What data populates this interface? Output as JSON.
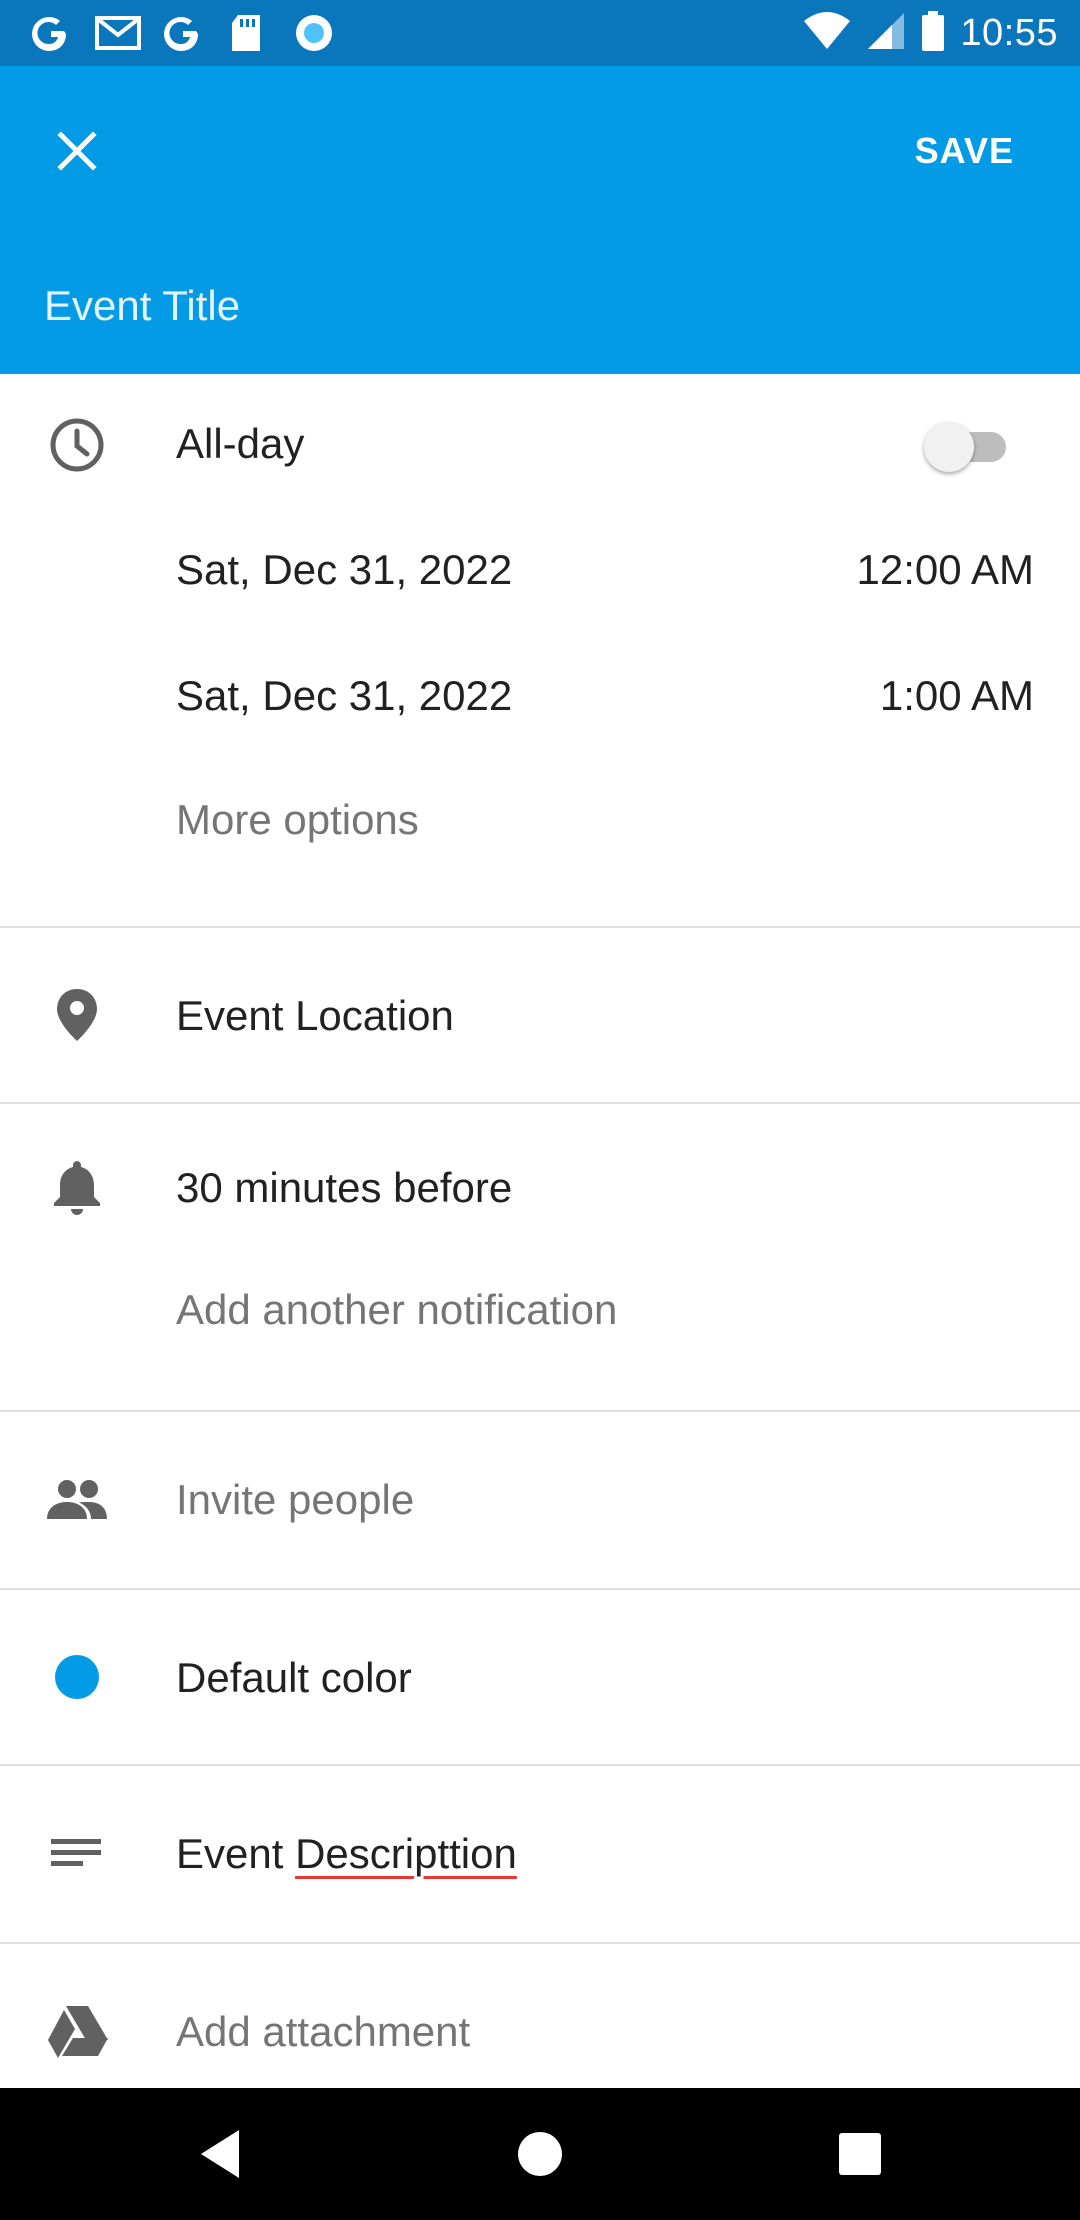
{
  "status_bar": {
    "time": "10:55",
    "left_icons": [
      "google-g-icon",
      "gmail-icon",
      "google-g-icon",
      "sd-card-icon",
      "record-icon"
    ],
    "right_icons": [
      "wifi-icon",
      "cell-signal-icon",
      "battery-icon"
    ]
  },
  "app_bar": {
    "close_icon": "close-icon",
    "save_label": "SAVE",
    "title_placeholder": "Event Title",
    "background_color": "#039be5"
  },
  "time_section": {
    "all_day_label": "All-day",
    "all_day_enabled": false,
    "start_date": "Sat, Dec 31, 2022",
    "start_time": "12:00 AM",
    "end_date": "Sat, Dec 31, 2022",
    "end_time": "1:00 AM",
    "more_options": "More options"
  },
  "location": {
    "placeholder": "Event Location"
  },
  "notifications": {
    "current": "30 minutes before",
    "add_label": "Add another notification"
  },
  "invite": {
    "label": "Invite people"
  },
  "color": {
    "label": "Default color",
    "value": "#039be5"
  },
  "description": {
    "word1": "Event",
    "word2": "Descripttion"
  },
  "attachment": {
    "label": "Add attachment"
  },
  "nav_bar": {
    "icons": [
      "back-icon",
      "home-icon",
      "recents-icon"
    ]
  }
}
